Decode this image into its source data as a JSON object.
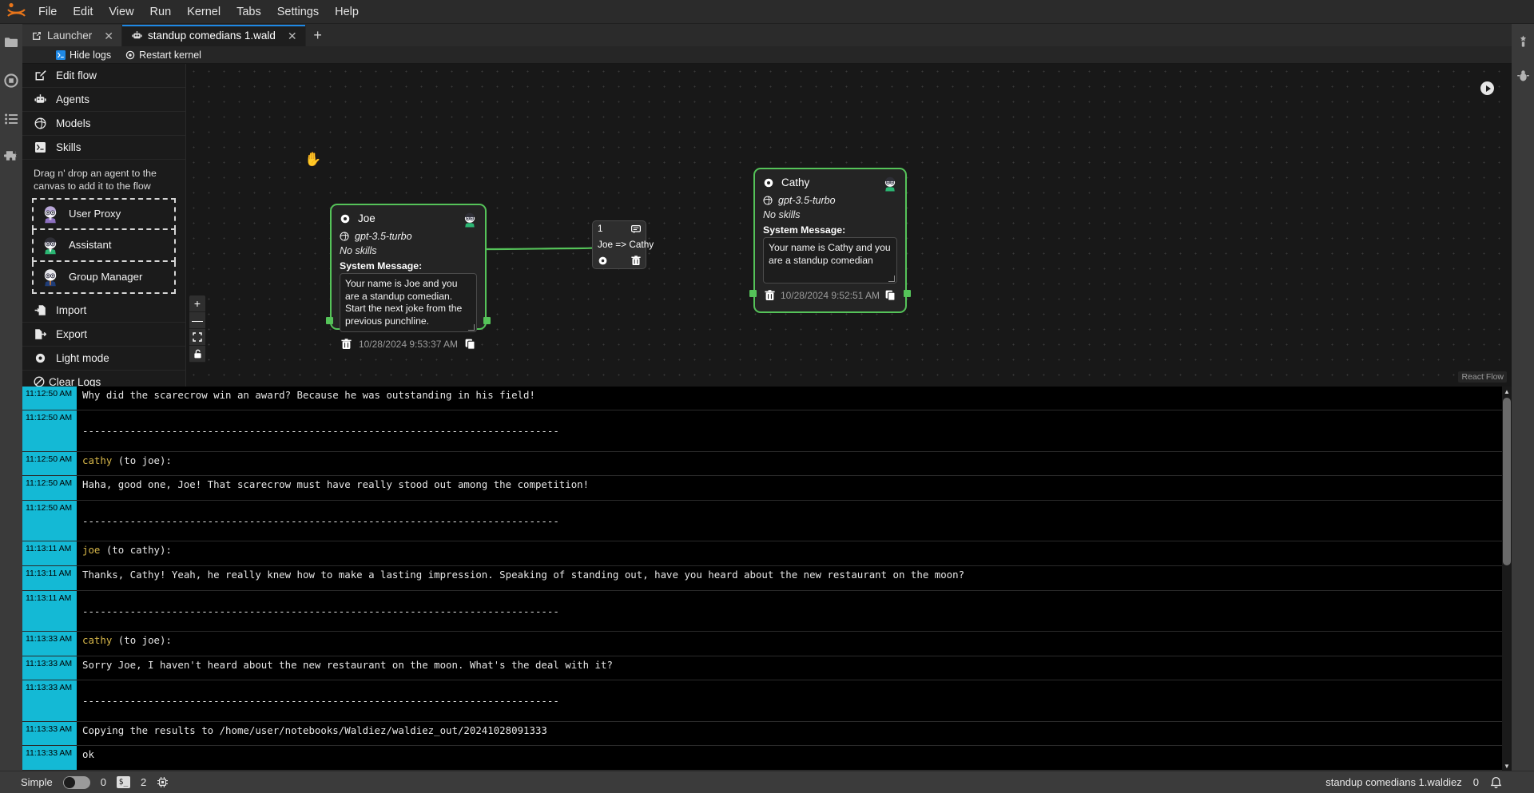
{
  "menubar": {
    "items": [
      "File",
      "Edit",
      "View",
      "Run",
      "Kernel",
      "Tabs",
      "Settings",
      "Help"
    ]
  },
  "tabs": [
    {
      "label": "Launcher",
      "icon": "launcher-icon",
      "active": false
    },
    {
      "label": "standup comedians 1.wald",
      "icon": "waldiez-icon",
      "active": true
    }
  ],
  "tab_add_label": "+",
  "toolbar": {
    "hide_logs": "Hide logs",
    "restart_kernel": "Restart kernel"
  },
  "sidebar": {
    "items": [
      {
        "label": "Edit flow",
        "icon": "edit-icon"
      },
      {
        "label": "Agents",
        "icon": "robot-icon"
      },
      {
        "label": "Models",
        "icon": "model-icon"
      },
      {
        "label": "Skills",
        "icon": "terminal-icon"
      }
    ],
    "hint": "Drag n' drop an agent to the canvas to add it to the flow",
    "agents": [
      {
        "label": "User Proxy",
        "icon": "user-proxy-avatar"
      },
      {
        "label": "Assistant",
        "icon": "assistant-avatar"
      },
      {
        "label": "Group Manager",
        "icon": "group-manager-avatar"
      }
    ],
    "tail": [
      {
        "label": "Import",
        "icon": "import-icon"
      },
      {
        "label": "Export",
        "icon": "export-icon"
      },
      {
        "label": "Light mode",
        "icon": "gear-icon"
      },
      {
        "label": "Clear Logs",
        "icon": "no-entry-icon"
      }
    ]
  },
  "canvas": {
    "zoom_controls": [
      "+",
      "—",
      "⛶",
      "🔓"
    ],
    "attribution": "React Flow",
    "nodes": [
      {
        "id": "joe",
        "title": "Joe",
        "model": "gpt-3.5-turbo",
        "skills": "No skills",
        "system_message_label": "System Message:",
        "system_message": "Your name is Joe and you are a standup comedian. Start the next joke from the previous punchline.",
        "timestamp": "10/28/2024 9:53:37 AM"
      },
      {
        "id": "cathy",
        "title": "Cathy",
        "model": "gpt-3.5-turbo",
        "skills": "No skills",
        "system_message_label": "System Message:",
        "system_message": "Your name is Cathy and you are a standup comedian",
        "timestamp": "10/28/2024 9:52:51 AM"
      }
    ],
    "edge": {
      "order": "1",
      "label": "Joe => Cathy"
    },
    "accent_color": "#55c359"
  },
  "logs": [
    {
      "time": "11:12:50 AM",
      "speaker": "",
      "text": "Why did the scarecrow win an award? Because he was outstanding in his field!"
    },
    {
      "time": "11:12:50 AM",
      "speaker": "",
      "text": "\n--------------------------------------------------------------------------------"
    },
    {
      "time": "11:12:50 AM",
      "speaker": "cathy",
      "text": " (to joe):"
    },
    {
      "time": "11:12:50 AM",
      "speaker": "",
      "text": "Haha, good one, Joe! That scarecrow must have really stood out among the competition!"
    },
    {
      "time": "11:12:50 AM",
      "speaker": "",
      "text": "\n--------------------------------------------------------------------------------"
    },
    {
      "time": "11:13:11 AM",
      "speaker": "joe",
      "text": " (to cathy):"
    },
    {
      "time": "11:13:11 AM",
      "speaker": "",
      "text": "Thanks, Cathy! Yeah, he really knew how to make a lasting impression. Speaking of standing out, have you heard about the new restaurant on the moon?"
    },
    {
      "time": "11:13:11 AM",
      "speaker": "",
      "text": "\n--------------------------------------------------------------------------------"
    },
    {
      "time": "11:13:33 AM",
      "speaker": "cathy",
      "text": " (to joe):"
    },
    {
      "time": "11:13:33 AM",
      "speaker": "",
      "text": "Sorry Joe, I haven't heard about the new restaurant on the moon. What's the deal with it?"
    },
    {
      "time": "11:13:33 AM",
      "speaker": "",
      "text": "\n--------------------------------------------------------------------------------"
    },
    {
      "time": "11:13:33 AM",
      "speaker": "",
      "text": "Copying the results to /home/user/notebooks/Waldiez/waldiez_out/20241028091333"
    },
    {
      "time": "11:13:33 AM",
      "speaker": "",
      "text": "ok"
    }
  ],
  "statusbar": {
    "mode_label": "Simple",
    "zero_left": "0",
    "kernel_chip": "$_",
    "kernel_count": "2",
    "file_label": "standup comedians 1.waldiez",
    "notifications": "0"
  }
}
